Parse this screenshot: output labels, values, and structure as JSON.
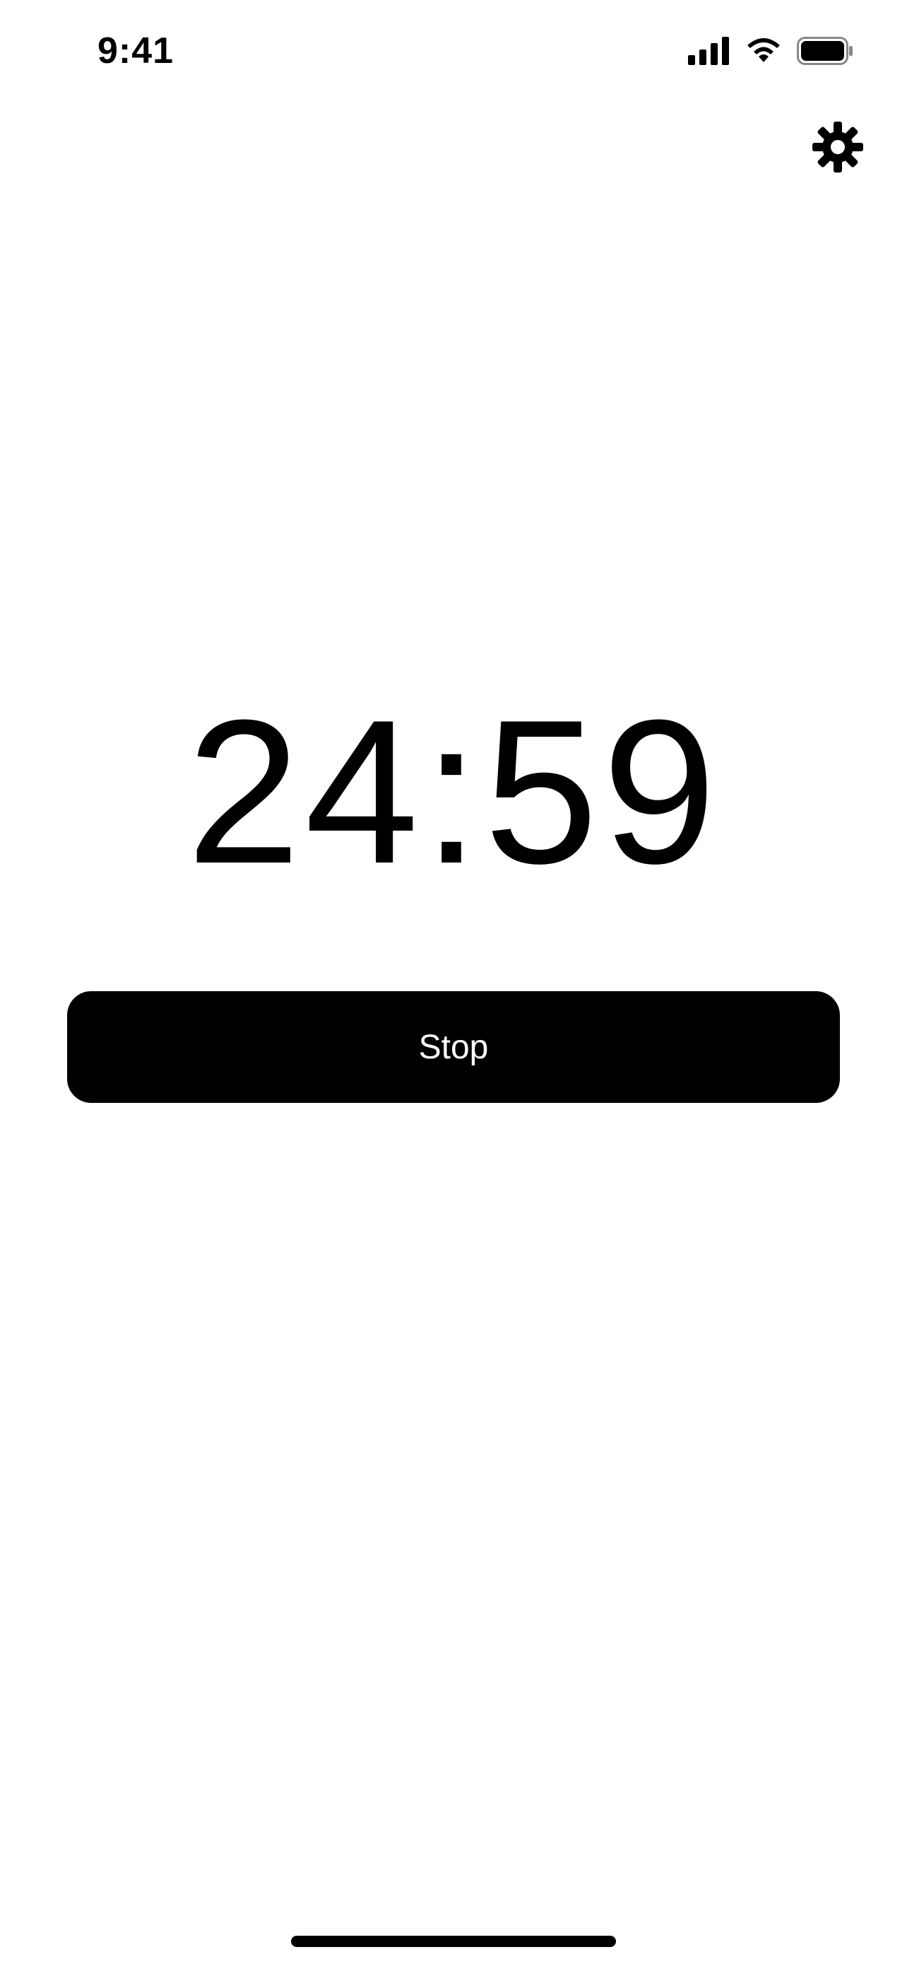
{
  "status_bar": {
    "time": "9:41",
    "signal_icon": "cellular-signal-icon",
    "wifi_icon": "wifi-icon",
    "battery_icon": "battery-icon"
  },
  "toolbar": {
    "settings_icon": "gear-icon"
  },
  "timer": {
    "display": "24:59"
  },
  "actions": {
    "stop_label": "Stop"
  },
  "colors": {
    "background": "#ffffff",
    "foreground": "#000000",
    "button_text": "#ffffff"
  }
}
